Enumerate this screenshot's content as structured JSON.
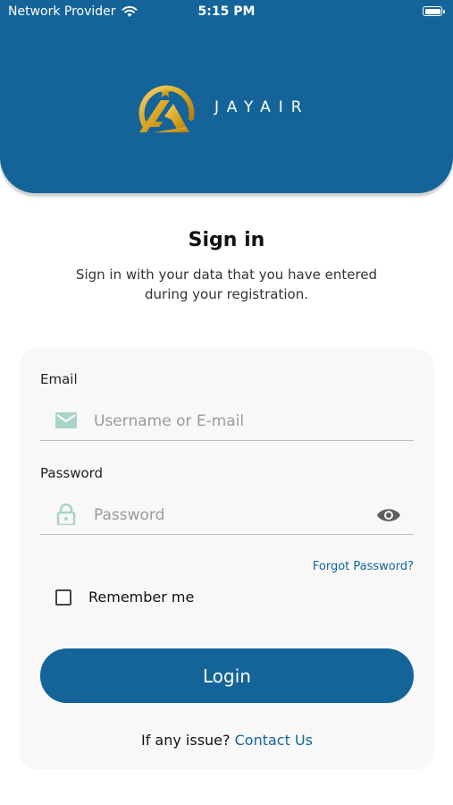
{
  "status_bar": {
    "carrier": "Network Provider",
    "time": "5:15 PM",
    "icons": [
      "wifi-icon",
      "battery-icon"
    ]
  },
  "header": {
    "brand": "JAYAIR",
    "logo": "jayair-logo",
    "background_color": "#14649a",
    "logo_color": "#d9a520"
  },
  "signin": {
    "title": "Sign in",
    "subtitle_line1": "Sign in with your data that you have entered",
    "subtitle_line2": "during your registration."
  },
  "form": {
    "email": {
      "label": "Email",
      "placeholder": "Username or E-mail",
      "value": "",
      "icon": "mail-icon"
    },
    "password": {
      "label": "Password",
      "placeholder": "Password",
      "value": "",
      "icon": "lock-icon",
      "toggle_icon": "eye-icon"
    },
    "forgot_password": "Forgot Password?",
    "remember_me": {
      "label": "Remember me",
      "checked": false
    },
    "login_button": "Login",
    "issue_text": "If any issue?",
    "contact_link": "Contact Us"
  },
  "colors": {
    "primary": "#14649a",
    "icon_muted": "#a9d3c9",
    "card_bg": "#f8f8f8"
  }
}
